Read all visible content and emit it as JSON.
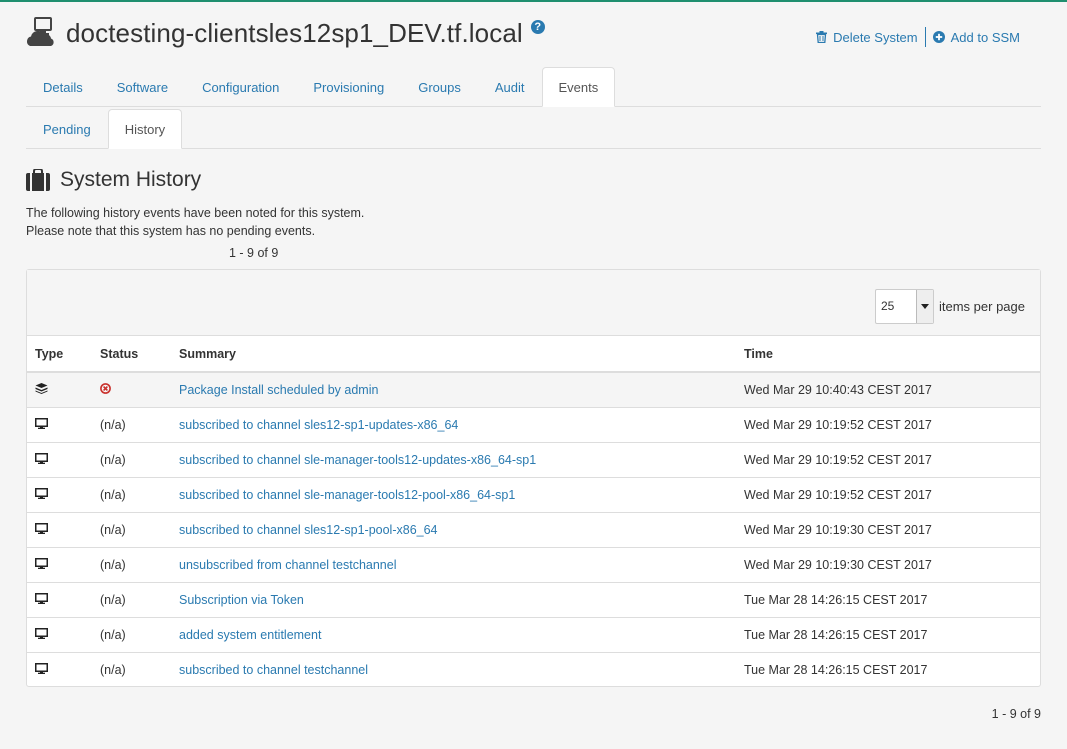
{
  "header": {
    "title": "doctesting-clientsles12sp1_DEV.tf.local",
    "help_glyph": "?",
    "actions": [
      {
        "label": "Delete System",
        "icon": "trash-icon"
      },
      {
        "label": "Add to SSM",
        "icon": "plus-circle-icon"
      }
    ]
  },
  "tabs": [
    "Details",
    "Software",
    "Configuration",
    "Provisioning",
    "Groups",
    "Audit",
    "Events"
  ],
  "active_tab": "Events",
  "subtabs": [
    "Pending",
    "History"
  ],
  "active_subtab": "History",
  "section": {
    "title": "System History",
    "icon": "briefcase-icon",
    "desc_line1": "The following history events have been noted for this system.",
    "desc_line2": "Please note that this system has no pending events."
  },
  "pager": {
    "top": "1 - 9 of 9",
    "bottom": "1 - 9 of 9"
  },
  "items_per_page": {
    "value": "25",
    "label": "items per page"
  },
  "table": {
    "headers": {
      "type": "Type",
      "status": "Status",
      "summary": "Summary",
      "time": "Time"
    },
    "rows": [
      {
        "type_icon": "packages-icon",
        "status": "",
        "status_icon": "failed-icon",
        "summary": "Package Install scheduled by admin",
        "time": "Wed Mar 29 10:40:43 CEST 2017"
      },
      {
        "type_icon": "desktop-icon",
        "status": "(n/a)",
        "summary": "subscribed to channel sles12-sp1-updates-x86_64",
        "time": "Wed Mar 29 10:19:52 CEST 2017"
      },
      {
        "type_icon": "desktop-icon",
        "status": "(n/a)",
        "summary": "subscribed to channel sle-manager-tools12-updates-x86_64-sp1",
        "time": "Wed Mar 29 10:19:52 CEST 2017"
      },
      {
        "type_icon": "desktop-icon",
        "status": "(n/a)",
        "summary": "subscribed to channel sle-manager-tools12-pool-x86_64-sp1",
        "time": "Wed Mar 29 10:19:52 CEST 2017"
      },
      {
        "type_icon": "desktop-icon",
        "status": "(n/a)",
        "summary": "subscribed to channel sles12-sp1-pool-x86_64",
        "time": "Wed Mar 29 10:19:30 CEST 2017"
      },
      {
        "type_icon": "desktop-icon",
        "status": "(n/a)",
        "summary": "unsubscribed from channel testchannel",
        "time": "Wed Mar 29 10:19:30 CEST 2017"
      },
      {
        "type_icon": "desktop-icon",
        "status": "(n/a)",
        "summary": "Subscription via Token",
        "time": "Tue Mar 28 14:26:15 CEST 2017"
      },
      {
        "type_icon": "desktop-icon",
        "status": "(n/a)",
        "summary": "added system entitlement",
        "time": "Tue Mar 28 14:26:15 CEST 2017"
      },
      {
        "type_icon": "desktop-icon",
        "status": "(n/a)",
        "summary": "subscribed to channel testchannel",
        "time": "Tue Mar 28 14:26:15 CEST 2017"
      }
    ]
  },
  "colors": {
    "link": "#2a7ab0",
    "failed": "#c9302c",
    "accent_line": "#1f8f6f"
  }
}
